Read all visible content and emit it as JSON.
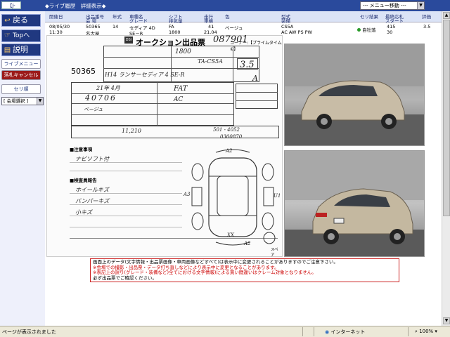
{
  "topbar": {
    "code": "【J-293】",
    "title": "◆ライブ履歴　詳細表示◆",
    "menu_select": "--- メニュー移動 ---"
  },
  "sidebar": {
    "back_label": "戻る",
    "top_label": "Topへ",
    "help_label": "説明",
    "live_menu": "ライブメニュー",
    "cancel_bid": "落札キャンセル",
    "sort_order": "セリ順",
    "venue_select": "[ 会場選択 ]"
  },
  "info": {
    "headers": [
      "開催日",
      "出品番号",
      "年式",
      "車種名",
      "シフト",
      "走行",
      "色",
      "型式",
      "セリ結果",
      "最終応札",
      "評価"
    ],
    "headers2": [
      "",
      "会 場",
      "",
      "グレード",
      "排気量",
      "車検",
      "",
      "装備",
      "",
      "スタート",
      ""
    ],
    "date": "08/05/30",
    "time": "11:30",
    "lot": "50365",
    "venue": "名古屋",
    "year": "14",
    "model": "セディア 4D",
    "grade": "SE－R",
    "shift": "FA",
    "cc": "1800",
    "mileage": "41",
    "inspection": "21.04",
    "color": "ベージュ",
    "type": "CS5A",
    "equipment": "AC AW PS PW",
    "result": "自社落",
    "final_bid": "415",
    "start": "30",
    "score": "3.5"
  },
  "sheet": {
    "title": "オークション出品票",
    "handwritten_no": "087901",
    "corner": "コーナー:【プライムタイム①】",
    "lot_number": "50365",
    "year_model": "H14 ランサーセディア 4 SE-R",
    "type_code": "TA-CS5A",
    "cc": "1800",
    "score": "3.5",
    "interior": "A",
    "mileage": "40706",
    "inspection": "21年 4月",
    "shift": "FAT",
    "ac": "AC",
    "color": "ベージュ",
    "recycle": "11,210",
    "chassis": "501 - 4052",
    "code_no": "0300870",
    "notes_title": "■注意事項",
    "note1": "ナビソフト付",
    "inspector_title": "■検査員報告",
    "report1": "ホイールキズ",
    "report2": "バンパーキズ",
    "report3": "小キズ",
    "diagram_marks": [
      "A2",
      "A3",
      "U1",
      "XX",
      "A2"
    ],
    "spare_label": "スペア"
  },
  "notice": {
    "line1": "画面上のデータ(文字情報・出品票画像・車両画像などすべて)は表示中に変更されることがありますのでご注意下さい。",
    "line2": "※会場での撮影・出品票・データ打ち直しなどにより表示中に変更となることがあります。",
    "line3": "※表記上の誤り(グレード・装備など)全てにおける文字情報)による買い間違いはクレーム対象となりません。",
    "line4": "必ず出品票でご確認ください。"
  },
  "statusbar": {
    "text": "ページが表示されました",
    "zone": "インターネット",
    "zoom": "100%"
  }
}
